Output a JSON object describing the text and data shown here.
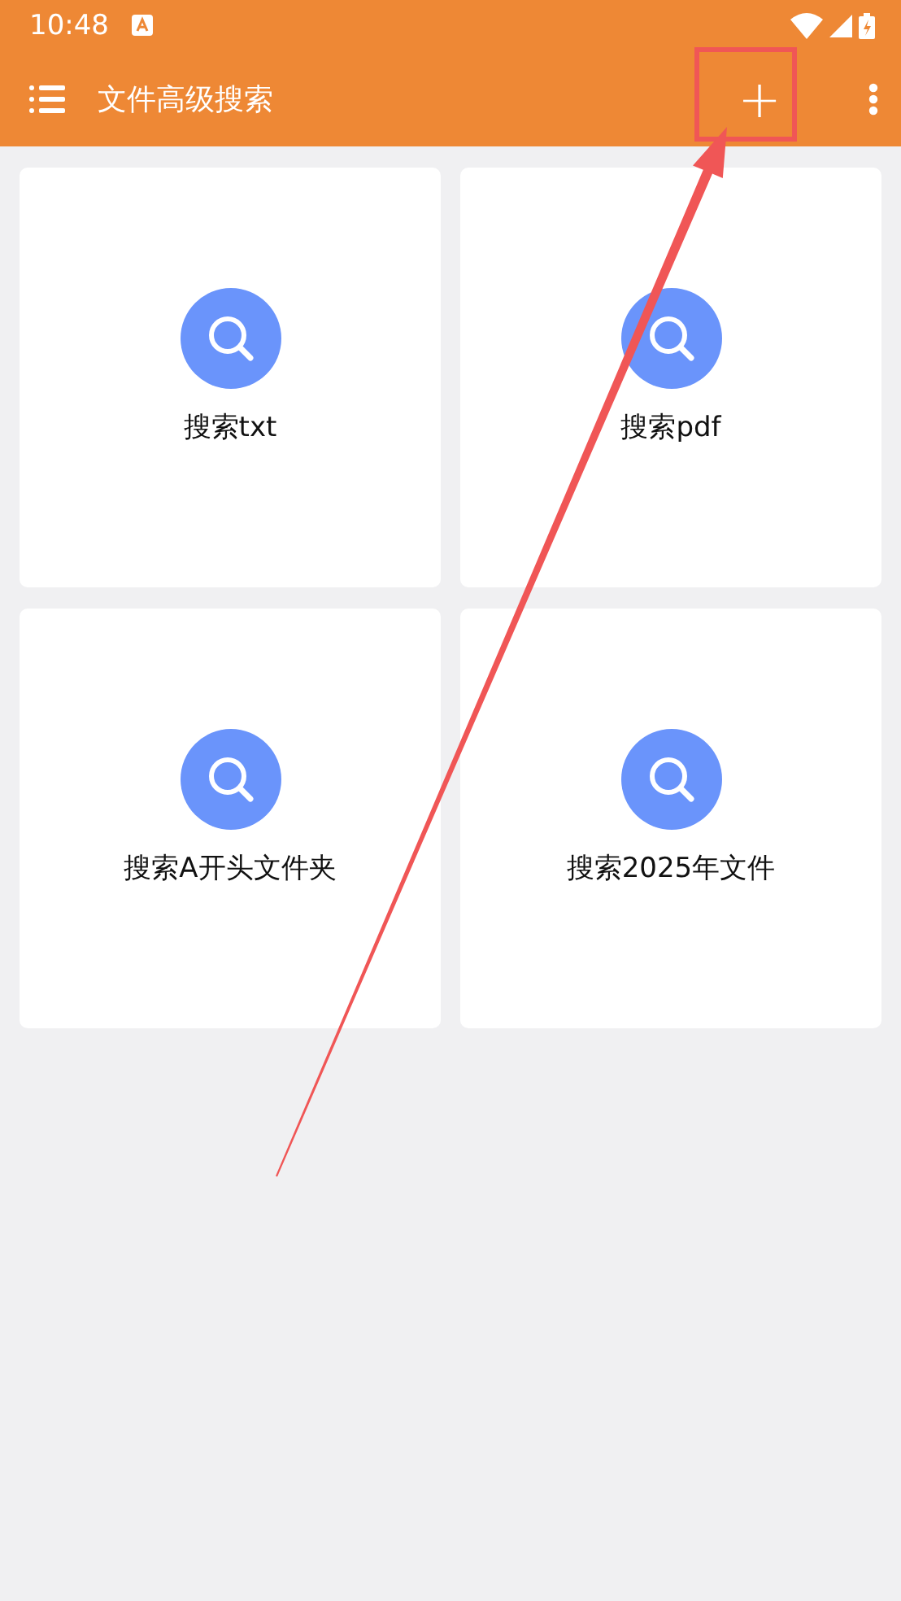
{
  "status_bar": {
    "time": "10:48"
  },
  "app_bar": {
    "title": "文件高级搜索",
    "add_label": "+"
  },
  "cards": [
    {
      "label": "搜索txt"
    },
    {
      "label": "搜索pdf"
    },
    {
      "label": "搜索A开头文件夹"
    },
    {
      "label": "搜索2025年文件"
    }
  ]
}
